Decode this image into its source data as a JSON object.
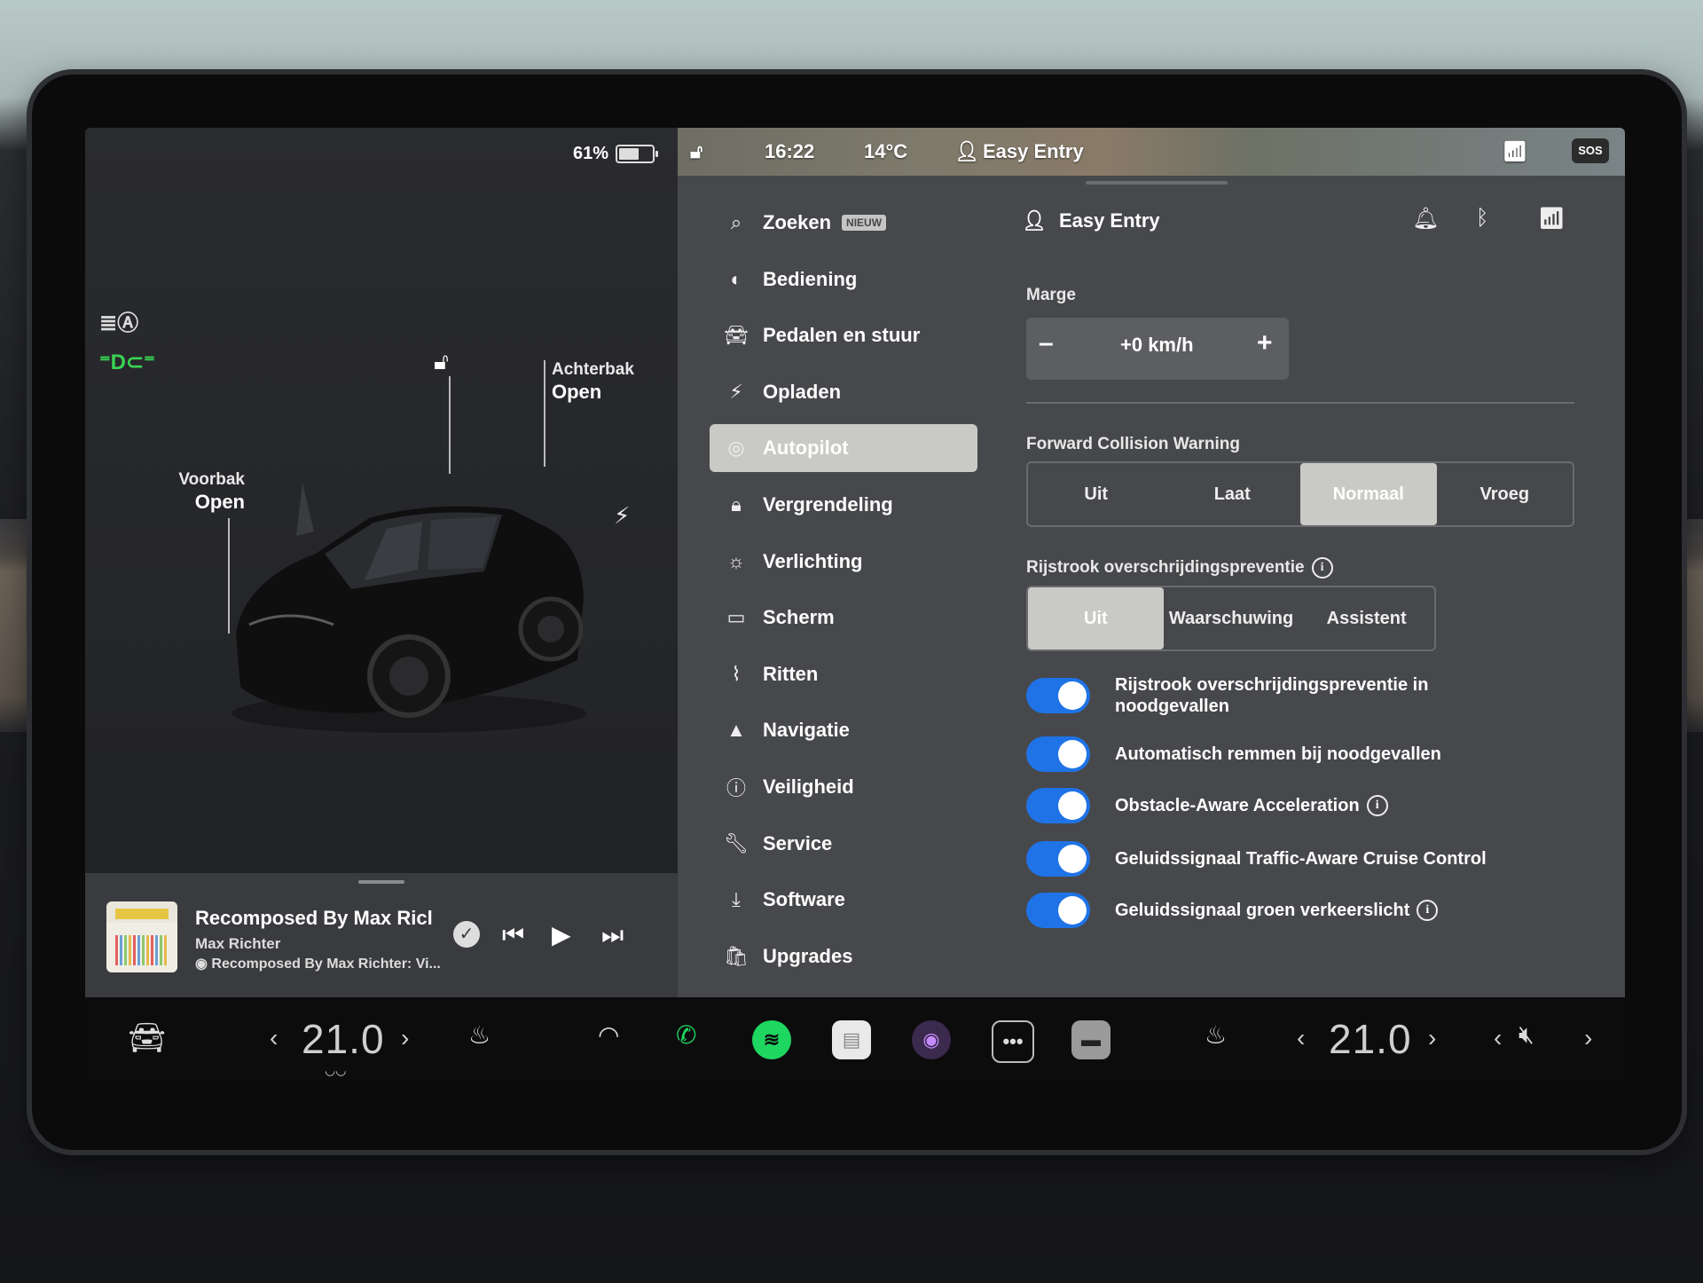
{
  "status": {
    "battery": "61%",
    "battery_fraction": 0.61,
    "time": "16:22",
    "temperature": "14°C",
    "profile": "Easy Entry",
    "sos": "SOS"
  },
  "car": {
    "frunk_label": "Voorbak",
    "frunk_state": "Open",
    "trunk_label": "Achterbak",
    "trunk_state": "Open"
  },
  "media": {
    "title": "Recomposed By Max Ricl",
    "artist": "Max Richter",
    "source": "Recomposed By Max Richter: Vi..."
  },
  "menu": {
    "items": [
      {
        "label": "Zoeken",
        "icon": "search-icon",
        "badge": "NIEUW"
      },
      {
        "label": "Bediening",
        "icon": "toggle-icon"
      },
      {
        "label": "Pedalen en stuur",
        "icon": "car-icon"
      },
      {
        "label": "Opladen",
        "icon": "bolt-icon"
      },
      {
        "label": "Autopilot",
        "icon": "steering-wheel-icon"
      },
      {
        "label": "Vergrendeling",
        "icon": "lock-icon"
      },
      {
        "label": "Verlichting",
        "icon": "sun-icon"
      },
      {
        "label": "Scherm",
        "icon": "display-icon"
      },
      {
        "label": "Ritten",
        "icon": "trips-icon"
      },
      {
        "label": "Navigatie",
        "icon": "navigation-icon"
      },
      {
        "label": "Veiligheid",
        "icon": "safety-icon"
      },
      {
        "label": "Service",
        "icon": "wrench-icon"
      },
      {
        "label": "Software",
        "icon": "download-icon"
      },
      {
        "label": "Upgrades",
        "icon": "bag-icon"
      }
    ]
  },
  "panel": {
    "profile": "Easy Entry",
    "marge_label": "Marge",
    "marge_value": "+0 km/h",
    "minus": "–",
    "plus": "+",
    "fcw_label": "Forward Collision Warning",
    "fcw_options": [
      "Uit",
      "Laat",
      "Normaal",
      "Vroeg"
    ],
    "fcw_selected": "Normaal",
    "lane_label": "Rijstrook overschrijdingspreventie",
    "lane_options": [
      "Uit",
      "Waarschuwing",
      "Assistent"
    ],
    "lane_selected": "Uit",
    "toggles": [
      {
        "label": "Rijstrook overschrijdingspreventie in noodgevallen",
        "on": true
      },
      {
        "label": "Automatisch remmen bij noodgevallen",
        "on": true
      },
      {
        "label": "Obstacle-Aware Acceleration",
        "on": true
      },
      {
        "label": "Geluidssignaal Traffic-Aware Cruise Control",
        "on": true
      },
      {
        "label": "Geluidssignaal groen verkeerslicht",
        "on": true
      }
    ]
  },
  "dock": {
    "temp_left": "21.0",
    "temp_right": "21.0",
    "accent_green": "#1ed760",
    "toggle_blue": "#1f73e6"
  }
}
